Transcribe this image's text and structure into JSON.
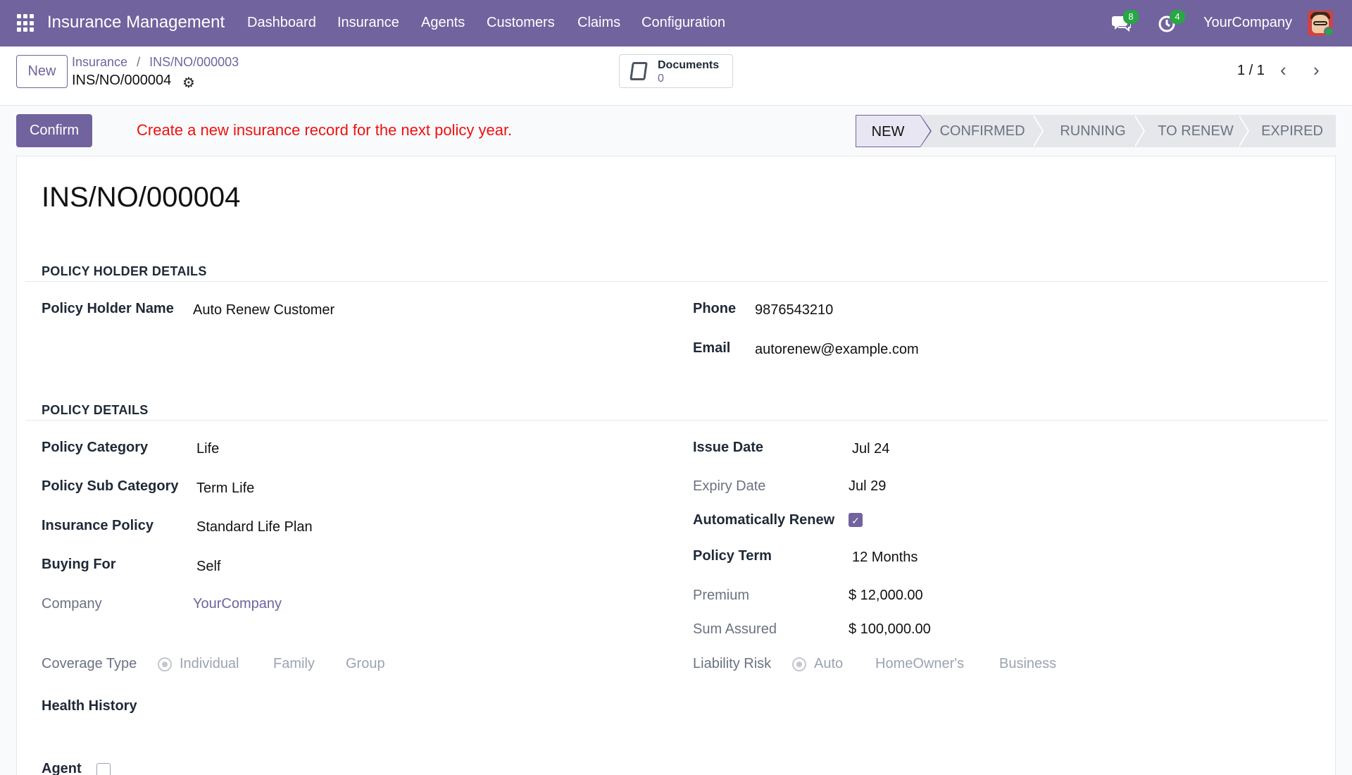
{
  "navbar": {
    "app_name": "Insurance Management",
    "menu": [
      "Dashboard",
      "Insurance",
      "Agents",
      "Customers",
      "Claims",
      "Configuration"
    ],
    "messages_count": "8",
    "activities_count": "4",
    "company": "YourCompany",
    "colors": {
      "primary": "#71639e",
      "badge": "#28a745"
    }
  },
  "control": {
    "new_label": "New",
    "breadcrumb": [
      "Insurance",
      "INS/NO/000003"
    ],
    "record_name": "INS/NO/000004",
    "documents_label": "Documents",
    "documents_count": "0",
    "pager": "1 / 1"
  },
  "actions": {
    "confirm_label": "Confirm",
    "notice": "Create a new insurance record for the next policy year.",
    "notice_color": "#e11d1d",
    "stages": [
      "NEW",
      "CONFIRMED",
      "RUNNING",
      "TO RENEW",
      "EXPIRED"
    ],
    "active_stage": "NEW"
  },
  "form": {
    "title": "INS/NO/000004",
    "holder_section": "POLICY HOLDER DETAILS",
    "holder_name_label": "Policy Holder Name",
    "holder_name": "Auto Renew Customer",
    "phone_label": "Phone",
    "phone": "9876543210",
    "email_label": "Email",
    "email": "autorenew@example.com",
    "policy_section": "POLICY DETAILS",
    "category_label": "Policy Category",
    "category": "Life",
    "sub_category_label": "Policy Sub Category",
    "sub_category": "Term Life",
    "policy_label": "Insurance Policy",
    "policy": "Standard Life Plan",
    "buying_for_label": "Buying For",
    "buying_for": "Self",
    "company_label": "Company",
    "company": "YourCompany",
    "issue_date_label": "Issue Date",
    "issue_date": "Jul 24",
    "expiry_date_label": "Expiry Date",
    "expiry_date": "Jul 29",
    "auto_renew_label": "Automatically Renew",
    "auto_renew": true,
    "policy_term_label": "Policy Term",
    "policy_term": "12 Months",
    "premium_label": "Premium",
    "premium": "$ 12,000.00",
    "sum_assured_label": "Sum Assured",
    "sum_assured": "$ 100,000.00",
    "coverage_type_label": "Coverage Type",
    "coverage_options": [
      "Individual",
      "Family",
      "Group"
    ],
    "liability_risk_label": "Liability Risk",
    "liability_options": [
      "Auto",
      "HomeOwner's",
      "Business"
    ],
    "health_history_label": "Health History",
    "agent_label": "Agent"
  }
}
